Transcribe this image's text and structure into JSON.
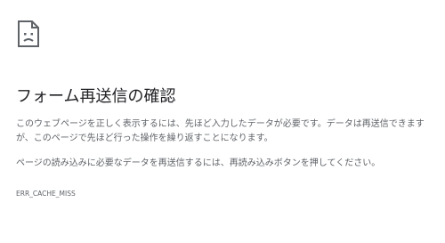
{
  "page": {
    "icon": "sad-document-icon",
    "title": "フォーム再送信の確認",
    "paragraph1": "このウェブページを正しく表示するには、先ほど入力したデータが必要です。データは再送信できますが、このページで先ほど行った操作を繰り返すことになります。",
    "paragraph2": "ページの読み込みに必要なデータを再送信するには、再読み込みボタンを押してください。",
    "error_code": "ERR_CACHE_MISS"
  },
  "colors": {
    "title": "#202124",
    "text": "#5f6368",
    "background": "#ffffff"
  }
}
